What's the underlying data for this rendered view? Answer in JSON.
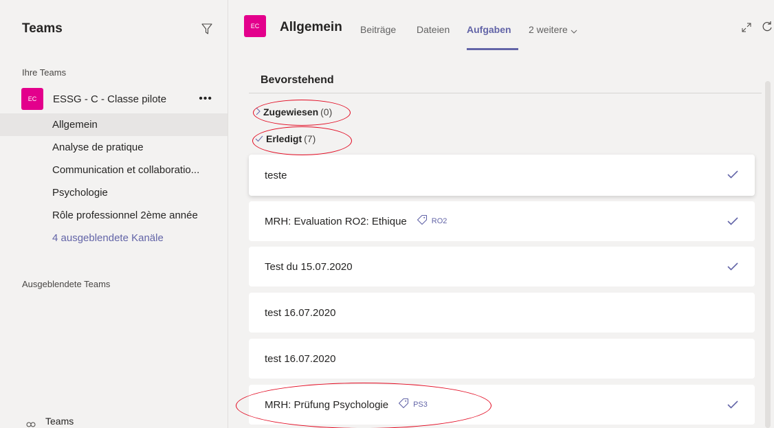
{
  "sidebar": {
    "title": "Teams",
    "your_teams_label": "Ihre Teams",
    "team": {
      "avatar_text": "EC",
      "name": "ESSG - C - Classe pilote",
      "more": "•••"
    },
    "channels": [
      {
        "label": "Allgemein",
        "active": true
      },
      {
        "label": "Analyse de pratique"
      },
      {
        "label": "Communication et collaboratio..."
      },
      {
        "label": "Psychologie"
      },
      {
        "label": "Rôle professionnel 2ème année"
      }
    ],
    "hidden_channels_link": "4 ausgeblendete Kanäle",
    "hidden_teams_label": "Ausgeblendete Teams",
    "footer_label": "Teams"
  },
  "header": {
    "avatar_text": "EC",
    "channel_title": "Allgemein",
    "tabs": [
      {
        "label": "Beiträge"
      },
      {
        "label": "Dateien"
      },
      {
        "label": "Aufgaben",
        "active": true
      },
      {
        "label": "2 weitere"
      }
    ]
  },
  "content": {
    "section_title": "Bevorstehend",
    "groups": [
      {
        "label": "Zugewiesen",
        "count": "(0)",
        "icon": "chevron-right-icon"
      },
      {
        "label": "Erledigt",
        "count": "(7)",
        "icon": "check-icon"
      }
    ],
    "tasks": [
      {
        "title": "teste",
        "tag": "",
        "done": true
      },
      {
        "title": "MRH: Evaluation RO2: Ethique",
        "tag": "RO2",
        "done": true
      },
      {
        "title": "Test du 15.07.2020",
        "tag": "",
        "done": true
      },
      {
        "title": "test 16.07.2020",
        "tag": "",
        "done": false
      },
      {
        "title": "test 16.07.2020",
        "tag": "",
        "done": false
      },
      {
        "title": "MRH: Prüfung Psychologie",
        "tag": "PS3",
        "done": true
      }
    ]
  },
  "colors": {
    "accent": "#6264a7",
    "avatar": "#e3008c",
    "annotation": "#e2061e"
  }
}
